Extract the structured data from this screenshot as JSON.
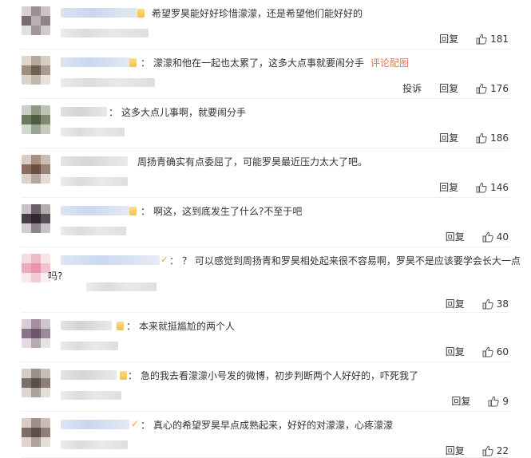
{
  "comments": [
    {
      "text": "希望罗昊能好好珍惜濛濛，还是希望他们能好好的",
      "reply": "回复",
      "likes": "181"
    },
    {
      "text": "濛濛和他在一起也太累了，这多大点事就要闹分手",
      "pic_link": "评论配图",
      "report": "投诉",
      "reply": "回复",
      "likes": "176"
    },
    {
      "text": "这多大点儿事啊，就要闹分手",
      "reply": "回复",
      "likes": "186"
    },
    {
      "text": "周扬青确实有点委屈了，可能罗昊最近压力太大了吧。",
      "reply": "回复",
      "likes": "146"
    },
    {
      "text": "啊这，这到底发生了什么?不至于吧",
      "reply": "回复",
      "likes": "40"
    },
    {
      "text": "？ 可以感觉到周扬青和罗昊相处起来很不容易啊，罗昊不是应该要学会长大一点吗?",
      "reply": "回复",
      "likes": "38"
    },
    {
      "text": "本来就挺尴尬的两个人",
      "reply": "回复",
      "likes": "60"
    },
    {
      "text": "急的我去看濛濛小号发的微博，初步判断两个人好好的，吓死我了",
      "reply": "回复",
      "likes": "9"
    },
    {
      "text": "真心的希望罗昊早点成熟起来，好好的对濛濛，心疼濛濛",
      "reply": "回复",
      "likes": "22"
    }
  ],
  "colors": {
    "text": "#333333",
    "link": "#eb7350",
    "divider": "#f0f0f0",
    "vip_badge": "#f5a623"
  },
  "icons": {
    "like": "thumbs-up-icon"
  }
}
